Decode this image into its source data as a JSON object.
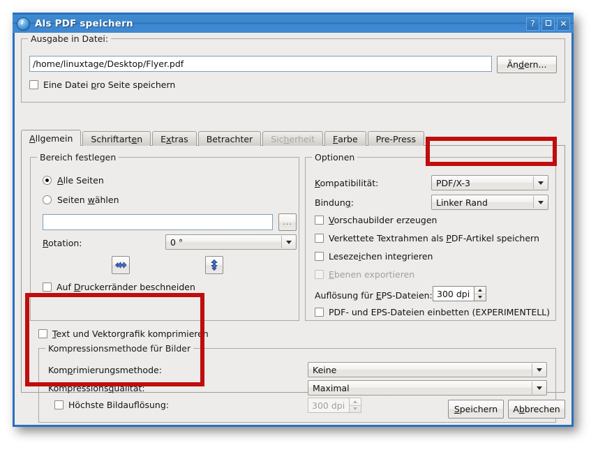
{
  "window": {
    "title": "Als PDF speichern",
    "icon": "globe-icon",
    "buttons": {
      "help": "?",
      "maximize": "maximize-icon",
      "close": "✕"
    },
    "accent_color": "#2a6fc0",
    "titlebar_color": "#3f8ad0",
    "background_color": "#edecea"
  },
  "output_group": {
    "legend": "Ausgabe in Datei:",
    "path_value": "/home/linuxtage/Desktop/Flyer.pdf",
    "path_placeholder": "",
    "change_button": "Ändern...",
    "one_file_per_page": {
      "label": "Eine Datei pro Seite speichern",
      "checked": false
    }
  },
  "tabs": [
    {
      "label": "Allgemein",
      "active": true,
      "disabled": false
    },
    {
      "label": "Schriftarten",
      "active": false,
      "disabled": false
    },
    {
      "label": "Extras",
      "active": false,
      "disabled": false
    },
    {
      "label": "Betrachter",
      "active": false,
      "disabled": false
    },
    {
      "label": "Sicherheit",
      "active": false,
      "disabled": true
    },
    {
      "label": "Farbe",
      "active": false,
      "disabled": false
    },
    {
      "label": "Pre-Press",
      "active": false,
      "disabled": false
    }
  ],
  "range_group": {
    "legend": "Bereich festlegen",
    "all_pages": {
      "label": "Alle Seiten",
      "selected": true
    },
    "select_pages": {
      "label": "Seiten wählen",
      "selected": false
    },
    "pages_value": "",
    "browse_button": "...",
    "rotation_label": "Rotation:",
    "rotation_value": "0 °",
    "flip_horizontal_icon": "flip-horizontal-icon",
    "flip_vertical_icon": "flip-vertical-icon",
    "crop_margins": {
      "label": "Auf Druckerränder beschneiden",
      "checked": false
    }
  },
  "options_group": {
    "legend": "Optionen",
    "compatibility_label": "Kompatibilität:",
    "compatibility_value": "PDF/X-3",
    "binding_label": "Bindung:",
    "binding_value": "Linker Rand",
    "thumbnails": {
      "label": "Vorschaubilder erzeugen",
      "checked": false
    },
    "linked_frames": {
      "label": "Verkettete Textrahmen als PDF-Artikel speichern",
      "checked": false
    },
    "bookmarks": {
      "label": "Lesezeichen integrieren",
      "checked": false
    },
    "layers": {
      "label": "Ebenen exportieren",
      "checked": false,
      "disabled": true
    },
    "eps_resolution_label": "Auflösung für EPS-Dateien:",
    "eps_resolution_value": "300 dpi",
    "embed_pdf_eps": {
      "label": "PDF- und EPS-Dateien einbetten (EXPERIMENTELL)",
      "checked": false
    }
  },
  "compression": {
    "compress_text_vector": {
      "label": "Text und Vektorgrafik komprimieren",
      "checked": false
    },
    "legend": "Kompressionsmethode für Bilder",
    "method_label": "Komprimierungsmethode:",
    "method_value": "Keine",
    "quality_label": "Kompressionsqualität:",
    "quality_value": "Maximal",
    "max_resolution": {
      "label": "Höchste Bildauflösung:",
      "checked": false
    },
    "max_resolution_value": "300 dpi"
  },
  "footer": {
    "save_button": "Speichern",
    "cancel_button": "Abbrechen"
  },
  "annotations": {
    "color": "#c00d0d",
    "boxes": [
      {
        "name": "compatibility-highlight"
      },
      {
        "name": "compression-highlight"
      }
    ]
  }
}
